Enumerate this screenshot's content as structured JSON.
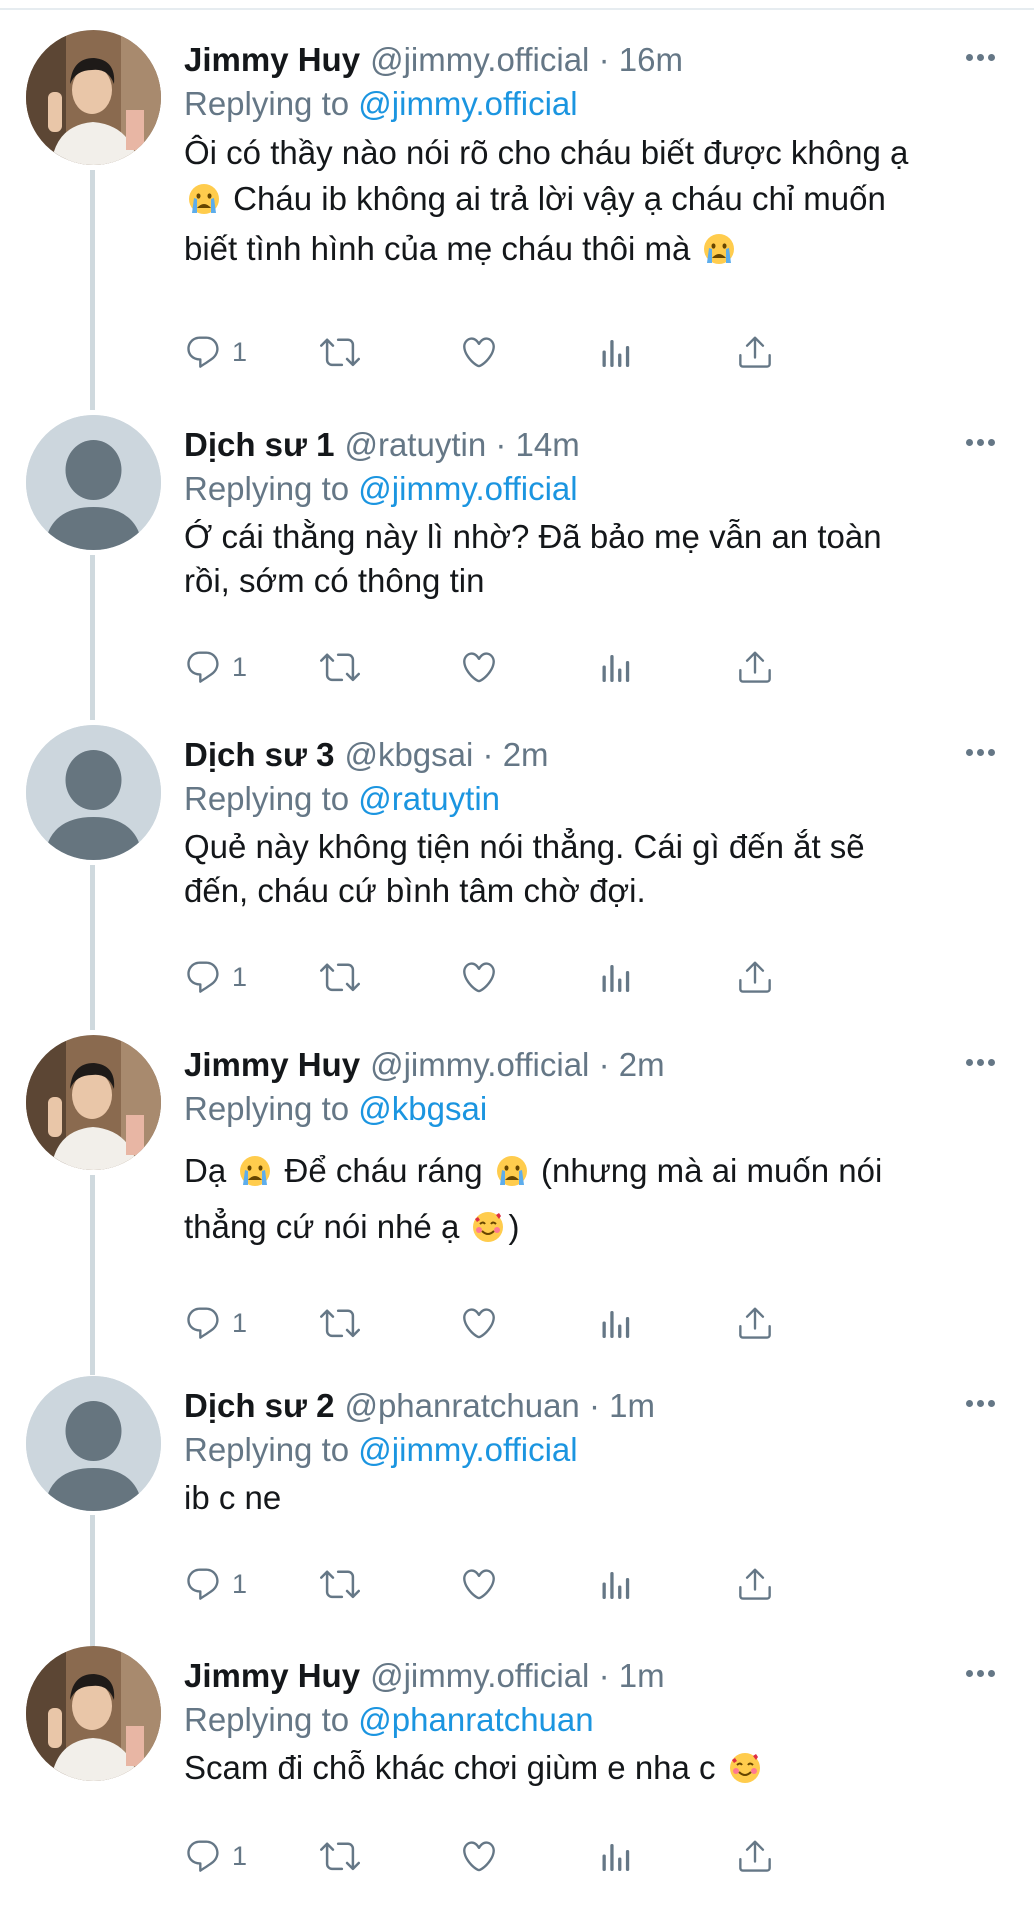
{
  "tweets": [
    {
      "name": "Jimmy Huy",
      "handle": "@jimmy.official",
      "separator": "·",
      "time": "16m",
      "replying_prefix": "Replying to",
      "replying_to": "@jimmy.official",
      "text_lines": [
        {
          "text": "Ôi có thầy nào nói rõ cho cháu biết được không ạ",
          "emoji_after": ""
        },
        {
          "text": "Cháu ib không ai trả lời vậy ạ cháu chỉ muốn",
          "emoji_before": "crying-face"
        },
        {
          "text": "biết tình hình của mẹ cháu thôi mà",
          "emoji_after": "crying-face"
        }
      ],
      "reply_count": "1",
      "avatar": "photo"
    },
    {
      "name": "Dịch sư 1",
      "handle": "@ratuytin",
      "separator": "·",
      "time": "14m",
      "replying_prefix": "Replying to",
      "replying_to": "@jimmy.official",
      "text_lines": [
        {
          "text": "Ớ cái thằng này lì nhờ? Đã bảo mẹ vẫn an toàn"
        },
        {
          "text": "rồi, sớm có thông tin"
        }
      ],
      "reply_count": "1",
      "avatar": "default"
    },
    {
      "name": "Dịch sư 3",
      "handle": "@kbgsai",
      "separator": "·",
      "time": "2m",
      "replying_prefix": "Replying to",
      "replying_to": "@ratuytin",
      "text_lines": [
        {
          "text": "Quẻ này không tiện nói thẳng. Cái gì đến ắt sẽ"
        },
        {
          "text": "đến, cháu cứ bình tâm chờ đợi."
        }
      ],
      "reply_count": "1",
      "avatar": "default"
    },
    {
      "name": "Jimmy Huy",
      "handle": "@jimmy.official",
      "separator": "·",
      "time": "2m",
      "replying_prefix": "Replying to",
      "replying_to": "@kbgsai",
      "text_lines": [
        {
          "segments": [
            "Dạ",
            "crying-face",
            "Để cháu ráng",
            "crying-face",
            "(nhưng mà ai muốn nói"
          ]
        },
        {
          "segments": [
            "thẳng cứ nói nhé ạ",
            "smiling-face-with-hearts",
            ")"
          ]
        }
      ],
      "reply_count": "1",
      "avatar": "photo"
    },
    {
      "name": "Dịch sư 2",
      "handle": "@phanratchuan",
      "separator": "·",
      "time": "1m",
      "replying_prefix": "Replying to",
      "replying_to": "@jimmy.official",
      "text_lines": [
        {
          "text": "ib c ne"
        }
      ],
      "reply_count": "1",
      "avatar": "default"
    },
    {
      "name": "Jimmy Huy",
      "handle": "@jimmy.official",
      "separator": "·",
      "time": "1m",
      "replying_prefix": "Replying to",
      "replying_to": "@phanratchuan",
      "text_lines": [
        {
          "text": "Scam đi chỗ khác chơi giùm e nha c",
          "emoji_after": "smiling-face-with-hearts"
        }
      ],
      "reply_count": "1",
      "avatar": "photo"
    }
  ],
  "icons": {
    "reply": "reply-icon",
    "retweet": "retweet-icon",
    "like": "heart-icon",
    "views": "analytics-icon",
    "share": "share-icon",
    "more": "more-icon"
  },
  "colors": {
    "name": "#14171a",
    "secondary": "#657786",
    "mention": "#1b95e0",
    "thread_line": "#cfd9de",
    "default_avatar_bg": "#ccd6dd",
    "default_avatar_fg": "#66757f"
  }
}
